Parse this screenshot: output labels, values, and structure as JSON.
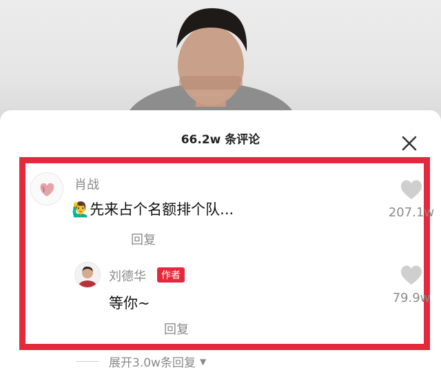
{
  "header": {
    "title": "66.2w 条评论",
    "close_icon": "close-icon"
  },
  "comments": [
    {
      "username": "肖战",
      "emoji": "🙋‍♂️",
      "text": "先来占个名额排个队...",
      "reply_label": "回复",
      "likes": "207.1w"
    }
  ],
  "reply": {
    "username": "刘德华",
    "badge": "作者",
    "text": "等你~",
    "reply_label": "回复",
    "likes": "79.9w"
  },
  "expand_label": "展开3.0w条回复",
  "colors": {
    "accent": "#e6283c",
    "muted": "#8a8a8a",
    "heart": "#cfcfcf"
  }
}
